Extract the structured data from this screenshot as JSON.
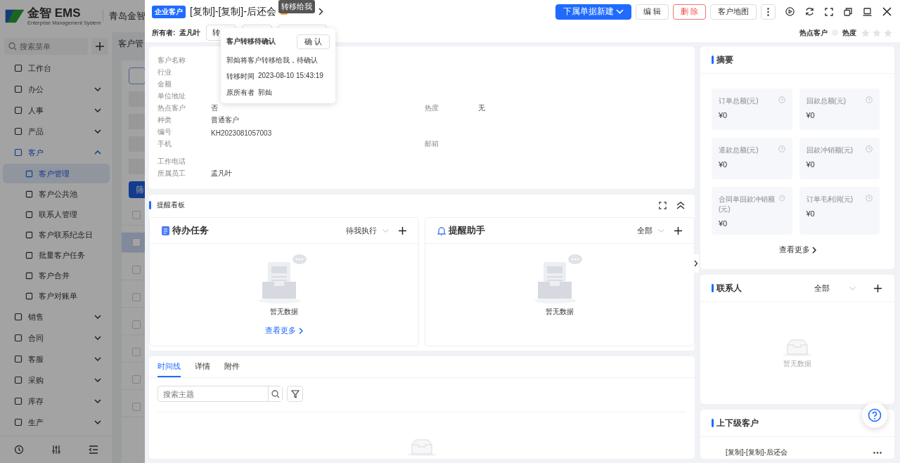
{
  "app": {
    "logo_name": "金智 EMS",
    "logo_subtitle": "Enterprise Management System",
    "company": "青岛金智",
    "search": {
      "placeholder": "搜索菜单"
    },
    "nav": [
      {
        "label": "工作台",
        "kind": "link",
        "expanded": false
      },
      {
        "label": "办公",
        "kind": "group",
        "expanded": false
      },
      {
        "label": "人事",
        "kind": "group",
        "expanded": false
      },
      {
        "label": "产品",
        "kind": "group",
        "expanded": false
      },
      {
        "label": "客户",
        "kind": "group",
        "expanded": true,
        "children": [
          {
            "label": "客户管理",
            "selected": true
          },
          {
            "label": "客户公共池",
            "selected": false
          },
          {
            "label": "联系人管理",
            "selected": false
          },
          {
            "label": "客户联系纪念日",
            "selected": false
          },
          {
            "label": "批量客户任务",
            "selected": false
          },
          {
            "label": "客户合并",
            "selected": false
          },
          {
            "label": "客户对账单",
            "selected": false
          }
        ]
      },
      {
        "label": "销售",
        "kind": "group",
        "expanded": false
      },
      {
        "label": "合同",
        "kind": "group",
        "expanded": false
      },
      {
        "label": "客服",
        "kind": "group",
        "expanded": false
      },
      {
        "label": "采购",
        "kind": "group",
        "expanded": false
      },
      {
        "label": "库存",
        "kind": "group",
        "expanded": false
      },
      {
        "label": "生产",
        "kind": "group",
        "expanded": false
      }
    ],
    "page_title": "客户管",
    "filter_button": "筛",
    "rows": [
      {
        "checked": false,
        "selected": false
      },
      {
        "checked": false,
        "selected": true
      },
      {
        "checked": false,
        "selected": false
      },
      {
        "checked": false,
        "selected": false
      },
      {
        "checked": false,
        "selected": false
      },
      {
        "checked": false,
        "selected": false
      },
      {
        "checked": false,
        "selected": false
      },
      {
        "checked": false,
        "selected": false
      }
    ]
  },
  "drawer": {
    "tag": "企业客户",
    "title": "[复制]-[复制]-后还会",
    "tooltip": "转移给我",
    "actions": [
      {
        "label": "下属单据新建",
        "kind": "primary"
      },
      {
        "label": "编 辑",
        "kind": "default"
      },
      {
        "label": "删 除",
        "kind": "danger"
      },
      {
        "label": "客户地图",
        "kind": "default"
      }
    ],
    "owner_label": "所有者:",
    "owner": "孟凡叶",
    "owner_buttons": [
      "转"
    ],
    "hot_label": "热点客户",
    "hot": false,
    "heat": {
      "label": "热度",
      "stars": 0
    },
    "popover": {
      "title": "客户转移待确认",
      "confirm": "确 认",
      "message": "郭灿将客户转移给我，待确认",
      "time_label": "转移时间",
      "time": "2023-08-10 15:43:19",
      "prev_label": "原所有者",
      "prev": "郭灿"
    },
    "info": [
      {
        "label": "客户名称"
      },
      {
        "label": "行业"
      },
      {
        "label": "金额"
      },
      {
        "label": "单位地址"
      },
      {
        "label": "热点客户",
        "value": "否",
        "label2": "热度",
        "value2": "无"
      },
      {
        "label": "种类",
        "value": "普通客户"
      },
      {
        "label": "编号",
        "value": "KH2023081057003"
      },
      {
        "label": "手机",
        "label2": "邮箱"
      },
      {
        "label": "工作电话"
      },
      {
        "label": "所属员工",
        "value": "孟凡叶"
      }
    ],
    "board": {
      "title": "提醒看板",
      "panels": [
        {
          "title": "待办任务",
          "kind": "task",
          "filter": "待我执行",
          "empty": "暂无数据",
          "more": "查看更多"
        },
        {
          "title": "提醒助手",
          "kind": "reminder",
          "filter": "全部",
          "empty": "暂无数据"
        }
      ]
    },
    "tabs": [
      {
        "label": "时间线",
        "selected": true
      },
      {
        "label": "详情",
        "selected": false
      },
      {
        "label": "附件",
        "selected": false
      }
    ],
    "timeline_search": {
      "placeholder": "搜索主题"
    },
    "summary": {
      "title": "摘要",
      "more": "查看更多",
      "metrics": [
        {
          "label": "订单总额(元)",
          "value": "¥0"
        },
        {
          "label": "回款总额(元)",
          "value": "¥0"
        },
        {
          "label": "退款总额(元)",
          "value": "¥0"
        },
        {
          "label": "回款冲销额(元)",
          "value": "¥0"
        },
        {
          "label": "合同单回款冲销额(元)",
          "value": "¥0"
        },
        {
          "label": "订单毛利润(元)",
          "value": "¥0"
        }
      ]
    },
    "contacts": {
      "title": "联系人",
      "filter": "全部",
      "empty": "暂无数据"
    },
    "relations": {
      "title": "上下级客户",
      "items": [
        "[复制]-[复制]-后还会"
      ]
    }
  }
}
